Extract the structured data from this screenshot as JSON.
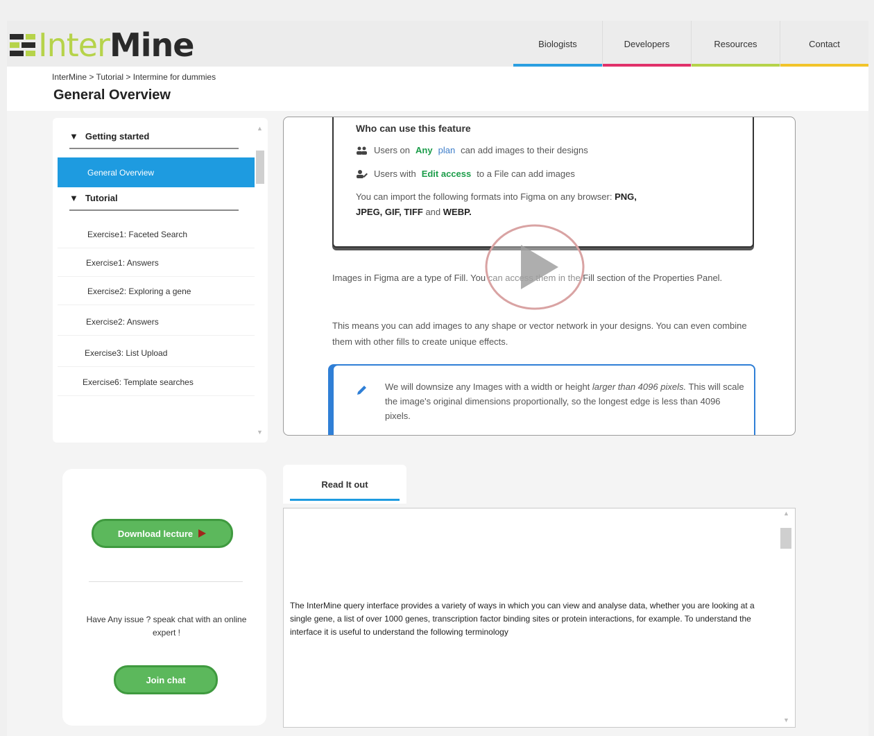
{
  "header": {
    "logo_text_a": "Inter",
    "logo_text_b": "Mine",
    "nav": [
      {
        "label": "Biologists",
        "color": "#2b9fe0"
      },
      {
        "label": "Developers",
        "color": "#e0316a"
      },
      {
        "label": "Resources",
        "color": "#b6d34a"
      },
      {
        "label": "Contact",
        "color": "#f2c42a"
      }
    ]
  },
  "breadcrumb": "InterMine  > Tutorial > Intermine for dummies",
  "page_title": "General Overview",
  "sidebar": {
    "section1": "Getting started",
    "active_item": "General Overview",
    "section2": "Tutorial",
    "items": [
      "Exercise1: Faceted Search",
      "Exercise1: Answers",
      "Exercise2: Exploring a gene",
      "Exercise2: Answers",
      "Exercise3: List Upload",
      "Exercise6: Template searches"
    ]
  },
  "content": {
    "feature_title": "Who can use this feature",
    "row1": {
      "a": "Users on",
      "b": "Any",
      "c": "plan",
      "d": "can add images to their designs"
    },
    "row2": {
      "a": "Users with",
      "b": "Edit access",
      "c": "to a File can add images"
    },
    "formats_a": "You can import the following formats into Figma on any browser:",
    "formats_png": "PNG,",
    "formats_jpeg": "JPEG,",
    "formats_gif": "GIF,",
    "formats_tiff": "TIFF",
    "formats_and": "and",
    "formats_webp": "WEBP.",
    "para1": "Images in Figma are a type of Fill. You can access them in the Fill section of the Properties Panel.",
    "para2": "This means you can add images to any shape or vector network in your designs. You can even combine them with other fills to create unique effects.",
    "note_a": "We will downsize any Images with a width or height",
    "note_em": "larger than 4096 pixels.",
    "note_b": "This will scale the image's original dimensions proportionally, so the longest edge is less than 4096 pixels."
  },
  "card": {
    "download_label": "Download lecture",
    "chat_text": "Have Any issue ? speak chat with an online expert !",
    "join_label": "Join chat"
  },
  "reader": {
    "tab_label": "Read It out",
    "text": "The InterMine query interface provides a variety of ways in which you can view and analyse data, whether you are looking at a single gene, a list of over 1000 genes, transcription factor binding sites or protein interactions, for example. To understand the interface it is useful to understand the following terminology"
  }
}
